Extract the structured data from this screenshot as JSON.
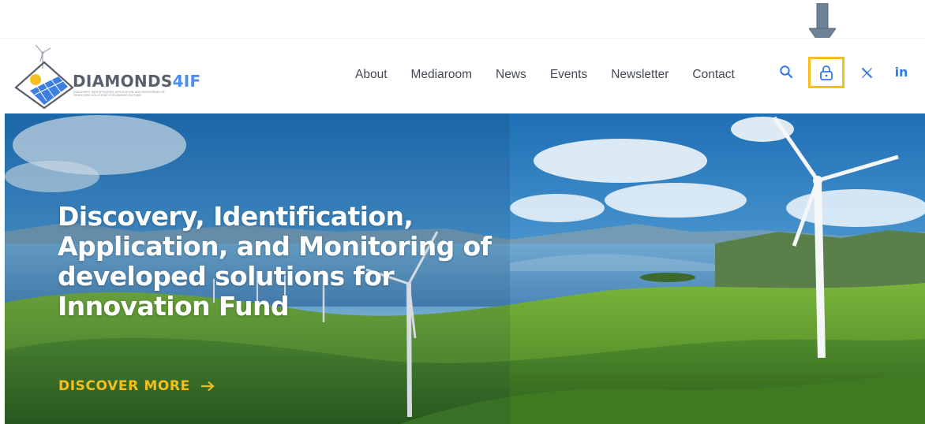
{
  "brand": {
    "name_main": "DIAMONDS",
    "name_accent": "4IF",
    "tagline_line1": "DISCOVERY, IDENTIFICATION, APPLICATION, AND MONITORING OF",
    "tagline_line2": "DEVELOPED SOLUTIONS FOR INNOVATION FUND"
  },
  "nav": {
    "items": [
      {
        "label": "About"
      },
      {
        "label": "Mediaroom"
      },
      {
        "label": "News"
      },
      {
        "label": "Events"
      },
      {
        "label": "Newsletter"
      },
      {
        "label": "Contact"
      }
    ]
  },
  "icons": {
    "search": "search-icon",
    "lock": "lock-icon",
    "x": "x-icon",
    "linkedin": "in",
    "annotation": "down-arrow-icon"
  },
  "hero": {
    "title_lines": [
      "Discovery, Identification,",
      "Application, and Monitoring of",
      "developed solutions for",
      "Innovation Fund"
    ],
    "cta_label": "DISCOVER MORE"
  },
  "colors": {
    "accent_yellow": "#f5c01d",
    "accent_blue": "#2f7bea",
    "nav_text": "#444a55",
    "annotation_arrow": "#6f8196"
  }
}
